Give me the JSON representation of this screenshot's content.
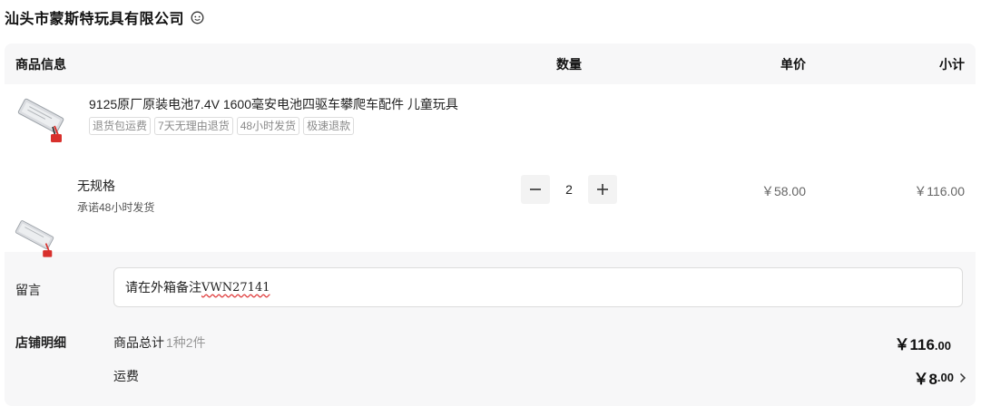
{
  "shop": {
    "name": "汕头市蒙斯特玩具有限公司",
    "chat_icon": "smile-chat-icon"
  },
  "table_header": {
    "goods": "商品信息",
    "quantity": "数量",
    "unit_price": "单价",
    "subtotal": "小计"
  },
  "item": {
    "title": "9125原厂原装电池7.4V 1600毫安电池四驱车攀爬车配件 儿童玩具",
    "tags": [
      "退货包运费",
      "7天无理由退货",
      "48小时发货",
      "极速退款"
    ],
    "spec": "无规格",
    "promise": "承诺48小时发货",
    "quantity": "2",
    "unit_price": "￥58.00",
    "line_total": "￥116.00"
  },
  "remark": {
    "label": "留言",
    "value_cn": "请在外箱备注",
    "value_code": "VWN27141"
  },
  "summary": {
    "label": "店铺明细",
    "goods_total_label": "商品总计",
    "goods_total_count": "1种2件",
    "goods_total_int": "￥116",
    "goods_total_cents": ".00",
    "shipping_label": "运费",
    "shipping_int": "￥8",
    "shipping_cents": ".00"
  },
  "colors": {
    "card_bg": "#f7f7f8",
    "tag_border": "#dcdcdc",
    "battery_plug": "#d8302c"
  }
}
